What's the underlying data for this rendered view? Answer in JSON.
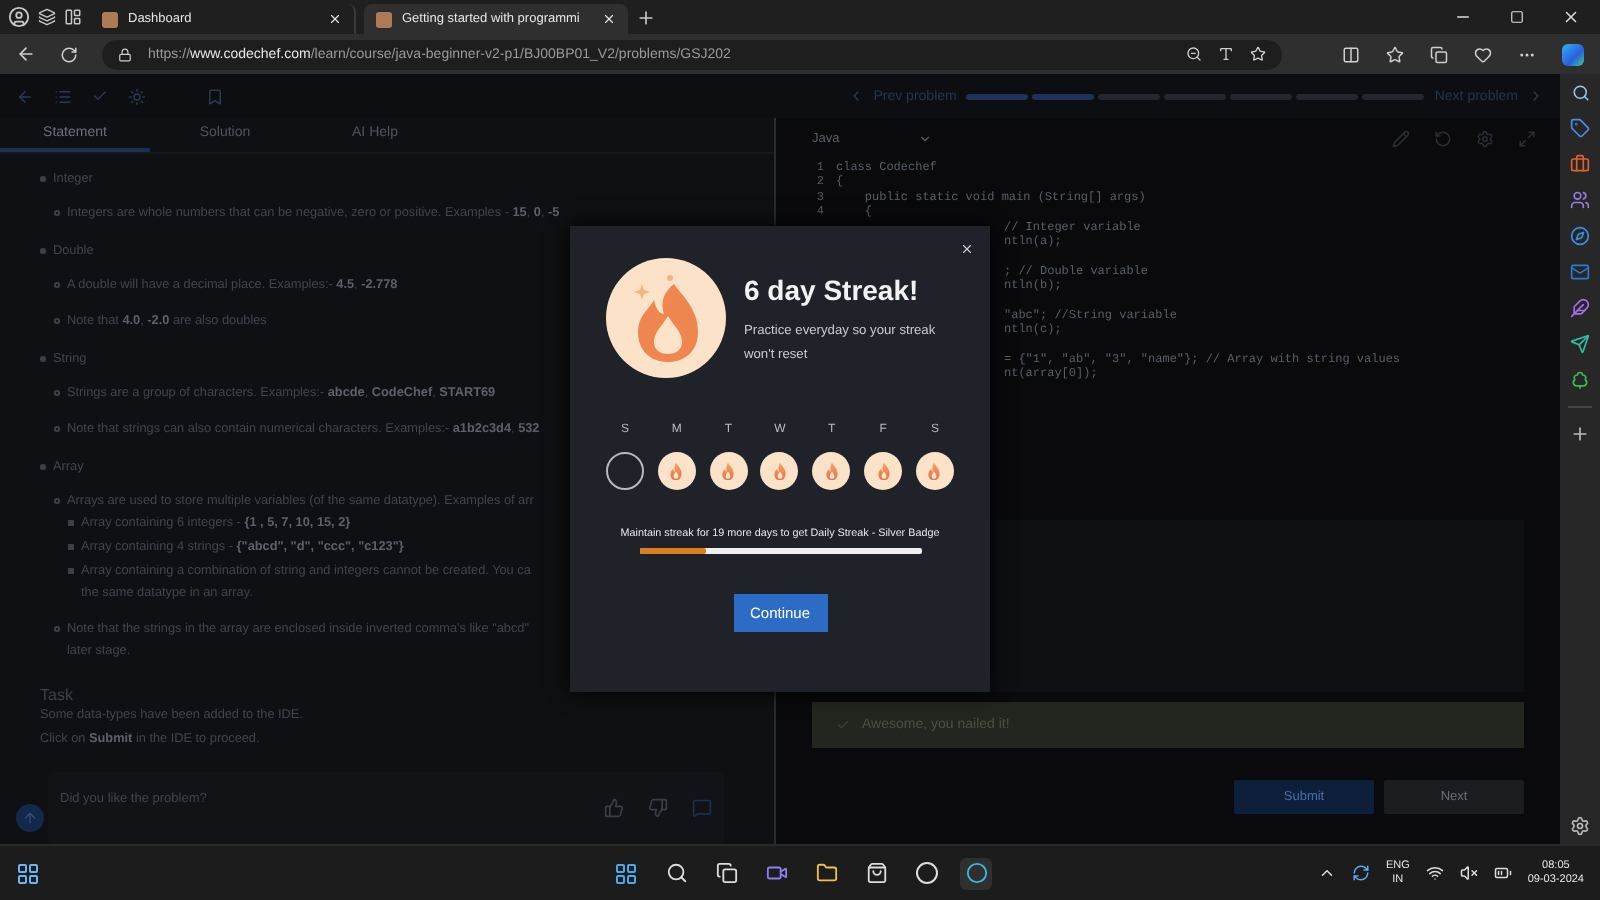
{
  "browser": {
    "tabs": [
      {
        "title": "Dashboard",
        "selected": false
      },
      {
        "title": "Getting started with programmi",
        "selected": true
      }
    ],
    "url": {
      "scheme": "https://",
      "host": "www.codechef.com",
      "path": "/learn/course/java-beginner-v2-p1/BJ00BP01_V2/problems/GSJ202"
    }
  },
  "problem_nav": {
    "prev": "Prev problem",
    "next": "Next problem",
    "segments": [
      {
        "completed": true
      },
      {
        "completed": true
      },
      {
        "completed": false
      },
      {
        "completed": false
      },
      {
        "completed": false
      },
      {
        "completed": false
      },
      {
        "completed": false
      }
    ]
  },
  "statement_tabs": [
    {
      "label": "Statement",
      "selected": true
    },
    {
      "label": "Solution",
      "selected": false
    },
    {
      "label": "AI Help",
      "selected": false
    }
  ],
  "statement": [
    {
      "text": "Integer",
      "children": [
        {
          "text": "Integers are whole numbers that can be negative, zero or positive. Examples - **15**, **0**, **-5**"
        }
      ]
    },
    {
      "text": "Double",
      "children": [
        {
          "text": "A double will have a decimal place. Examples:- **4.5**, **-2.778**"
        },
        {
          "text": "Note that **4.0**, **-2.0** are also doubles"
        }
      ]
    },
    {
      "text": "String",
      "children": [
        {
          "text": "Strings are a group of characters. Examples:- **abcde**, **CodeChef**, **START69**"
        },
        {
          "text": "Note that strings can also contain numerical characters. Examples:- **a1b2c3d4**, **532**"
        }
      ]
    },
    {
      "text": "Array",
      "children": [
        {
          "text": "Arrays are used to store multiple variables (of the same datatype). Examples of arr",
          "children": [
            {
              "text": "Array containing 6 integers - **{1 , 5, 7, 10, 15, 2}**"
            },
            {
              "text": "Array containing 4 strings - **{\"abcd\", \"d\", \"ccc\", \"c123\"}**"
            },
            {
              "text": "Array containing a combination of string and integers cannot be created. You ca",
              "continued": "the same datatype in an array."
            }
          ]
        },
        {
          "text": "Note that the strings in the array are enclosed inside inverted comma's like \"abcd\"",
          "continued": "later stage."
        }
      ]
    }
  ],
  "task": {
    "heading": "Task",
    "lines": [
      "Some data-types have been added to the IDE.",
      "Click on **Submit** in the IDE to proceed."
    ]
  },
  "feedback": {
    "question": "Did you like the problem?"
  },
  "editor": {
    "language": "Java",
    "lines": [
      {
        "number": "1",
        "code": "class Codechef"
      },
      {
        "number": "2",
        "code": "{"
      },
      {
        "number": "3",
        "code": "    public static void main (String[] args)"
      },
      {
        "number": "4",
        "code": "    {"
      },
      {
        "code": "// Integer variable",
        "after_blank": false
      },
      {
        "code": "ntln(a);",
        "after_blank": false
      },
      {
        "code": "; // Double variable",
        "after_blank": true
      },
      {
        "code": "ntln(b);",
        "after_blank": false
      },
      {
        "code": "\"abc\"; //String variable",
        "after_blank": true
      },
      {
        "code": "ntln(c);",
        "after_blank": false
      },
      {
        "code": "= {\"1\", \"ab\", \"3\", \"name\"}; // Array with string values",
        "after_blank": true
      },
      {
        "code": "nt(array[0]);",
        "after_blank": false
      }
    ]
  },
  "result": {
    "message": "Awesome, you nailed it!"
  },
  "actions": [
    {
      "label": "Submit",
      "kind": "primary"
    },
    {
      "label": "Next",
      "kind": "secondary"
    }
  ],
  "streak_modal": {
    "title": "6 day Streak!",
    "message": "Practice everyday so your streak won't reset",
    "days": [
      {
        "label": "S",
        "done": false
      },
      {
        "label": "M",
        "done": true
      },
      {
        "label": "T",
        "done": true
      },
      {
        "label": "W",
        "done": true
      },
      {
        "label": "T",
        "done": true
      },
      {
        "label": "F",
        "done": true
      },
      {
        "label": "S",
        "done": true
      }
    ],
    "progress_text": "Maintain streak for 19 more days to get Daily Streak - Silver Badge",
    "level": 0.24,
    "button": "Continue"
  },
  "taskbar": {
    "language": "ENG",
    "region": "IN",
    "time": "08:05",
    "date": "09-03-2024"
  }
}
